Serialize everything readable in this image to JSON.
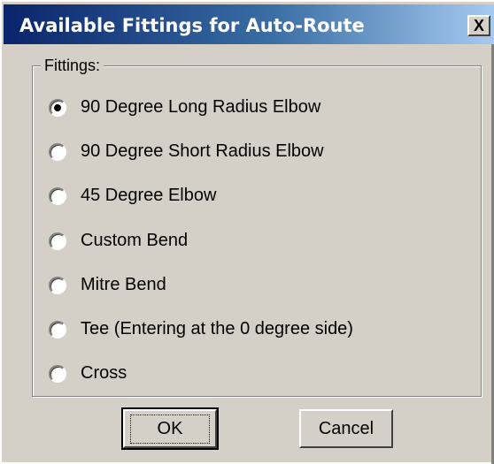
{
  "window": {
    "title": "Available Fittings for Auto-Route",
    "close_label": "X"
  },
  "group": {
    "label": "Fittings:"
  },
  "options": [
    {
      "label": "90 Degree Long Radius Elbow",
      "checked": true
    },
    {
      "label": "90 Degree Short Radius Elbow",
      "checked": false
    },
    {
      "label": "45 Degree Elbow",
      "checked": false
    },
    {
      "label": "Custom Bend",
      "checked": false
    },
    {
      "label": "Mitre Bend",
      "checked": false
    },
    {
      "label": "Tee (Entering at the 0 degree side)",
      "checked": false
    },
    {
      "label": "Cross",
      "checked": false
    }
  ],
  "buttons": {
    "ok_label": "OK",
    "cancel_label": "Cancel"
  },
  "colors": {
    "title_bar_start": "#0a246a",
    "title_bar_end": "#a6caf0",
    "face": "#d4d0c8"
  }
}
